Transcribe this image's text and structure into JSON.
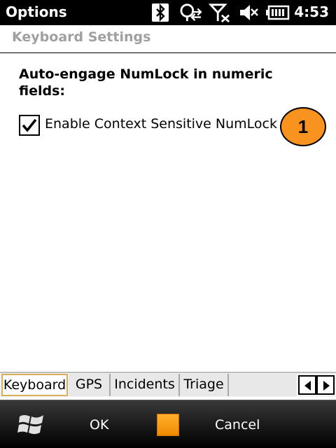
{
  "status_bar": {
    "title": "Options",
    "time": "4:53",
    "icons": [
      "bluetooth-icon",
      "connectivity-icon",
      "no-signal-icon",
      "speaker-muted-icon",
      "battery-icon"
    ]
  },
  "header": {
    "title": "Keyboard Settings"
  },
  "content": {
    "section_label": "Auto-engage NumLock in numeric fields:",
    "checkbox": {
      "label": "Enable Context Sensitive NumLock",
      "checked": true
    },
    "callout": "1"
  },
  "tabs": [
    {
      "label": "Keyboard",
      "active": true
    },
    {
      "label": "GPS",
      "active": false
    },
    {
      "label": "Incidents",
      "active": false
    },
    {
      "label": "Triage",
      "active": false
    }
  ],
  "menu_bar": {
    "left_softkey": "OK",
    "right_softkey": "Cancel",
    "icons": [
      "windows-start-icon",
      "keyboard-input-icon"
    ]
  },
  "colors": {
    "callout": "#f7931e",
    "header_text": "#a0a0a0",
    "active_tab_border": "#d7b15a"
  }
}
